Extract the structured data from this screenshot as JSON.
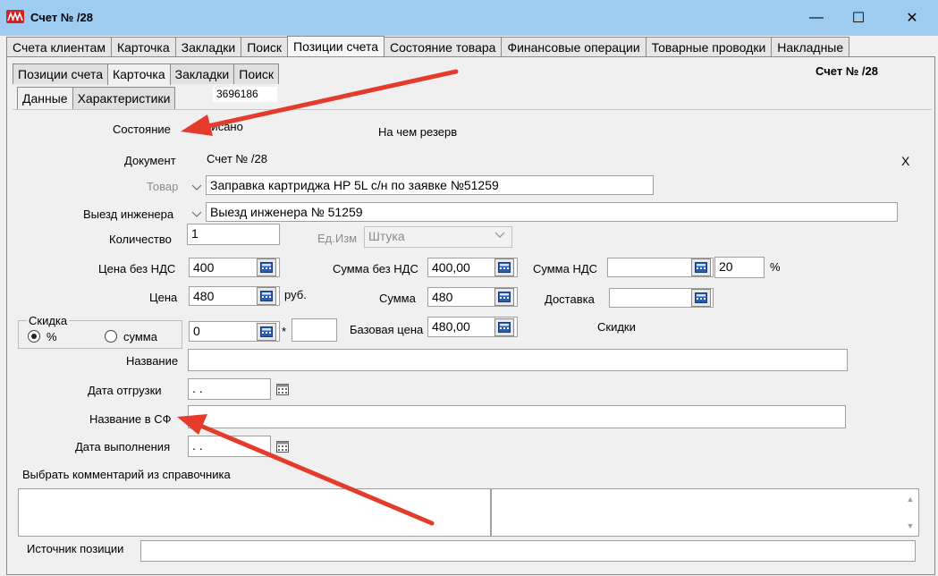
{
  "window": {
    "title": "Счет №  /28",
    "minimize": "—",
    "maximize": "☐",
    "close": "✕"
  },
  "main_tabs": [
    {
      "label": "Счета клиентам"
    },
    {
      "label": "Карточка"
    },
    {
      "label": "Закладки"
    },
    {
      "label": "Поиск"
    },
    {
      "label": "Позиции счета"
    },
    {
      "label": "Состояние товара"
    },
    {
      "label": "Финансовые операции"
    },
    {
      "label": "Товарные проводки"
    },
    {
      "label": "Накладные"
    }
  ],
  "sub_tabs": [
    {
      "label": "Позиции счета"
    },
    {
      "label": "Карточка"
    },
    {
      "label": "Закладки"
    },
    {
      "label": "Поиск"
    }
  ],
  "doc_ref": "Счет №  /28",
  "inner_tabs": [
    {
      "label": "Данные"
    },
    {
      "label": "Характеристики"
    }
  ],
  "tab_code": "3696186",
  "form": {
    "state_label": "Состояние",
    "state_value": "Списано",
    "reserve_label": "На чем резерв",
    "document_label": "Документ",
    "document_value": "Счет №  /28",
    "clear_x": "X",
    "product_label": "Товар",
    "product_value": "Заправка картриджа HP 5L с/н  по заявке №51259",
    "engineer_label": "Выезд инженера",
    "engineer_value": "Выезд инженера № 51259",
    "qty_label": "Количество",
    "qty_value": "1",
    "unit_label": "Ед.Изм",
    "unit_value": "Штука",
    "price_novat_label": "Цена без НДС",
    "price_novat_value": "400",
    "sum_novat_label": "Сумма без НДС",
    "sum_novat_value": "400,00",
    "vat_sum_label": "Сумма НДС",
    "vat_sum_value": "",
    "vat_rate_value": "20",
    "percent_sign": "%",
    "price_label": "Цена",
    "price_value": "480",
    "currency": "руб.",
    "sum_label": "Сумма",
    "sum_value": "480",
    "delivery_label": "Доставка",
    "delivery_value": "",
    "discount_group": "Скидка",
    "discount_percent": "%",
    "discount_sum": "сумма",
    "discount_value": "0",
    "multiply_sign": "*",
    "multiplier_value": "",
    "base_price_label": "Базовая цена",
    "base_price_value": "480,00",
    "discounts_label": "Скидки",
    "name_label": "Название",
    "name_value": "",
    "ship_date_label": "Дата отгрузки",
    "ship_date_value": " .  .",
    "sf_name_label": "Название в СФ",
    "sf_name_value": "",
    "done_date_label": "Дата выполнения",
    "done_date_value": " .  .",
    "comment_label": "Выбрать комментарий из справочника",
    "source_label": "Источник позиции",
    "source_value": ""
  },
  "colors": {
    "titlebar": "#9ecbf0",
    "arrow": "#e53b2c"
  }
}
